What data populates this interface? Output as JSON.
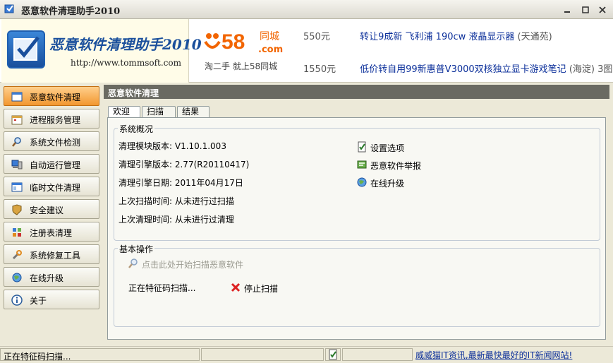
{
  "window": {
    "title": "恶意软件清理助手2010",
    "controls": [
      "minimize",
      "maximize",
      "close"
    ]
  },
  "banner": {
    "logo_title": "恶意软件清理助手2010",
    "logo_url": "http://www.tommsoft.com",
    "ad_brand_number": "58",
    "ad_brand_suffix": "同城",
    "ad_brand_domain": ".com",
    "ad_slogan": "淘二手  就上58同城",
    "ads": [
      {
        "price": "550元",
        "text": "转让9成新  飞利浦  190cw  液晶显示器",
        "extra": "(天通苑)"
      },
      {
        "price": "1550元",
        "text": "低价转自用99新惠普V3000双核独立显卡游戏笔记",
        "extra": "(海淀)  3图"
      }
    ]
  },
  "sidebar": {
    "items": [
      {
        "label": "恶意软件清理",
        "icon": "window-icon",
        "active": true
      },
      {
        "label": "进程服务管理",
        "icon": "calendar-icon",
        "active": false
      },
      {
        "label": "系统文件检测",
        "icon": "magnifier-icon",
        "active": false
      },
      {
        "label": "自动运行管理",
        "icon": "computer-icon",
        "active": false
      },
      {
        "label": "临时文件清理",
        "icon": "window-icon",
        "active": false
      },
      {
        "label": "安全建议",
        "icon": "shield-icon",
        "active": false
      },
      {
        "label": "注册表清理",
        "icon": "registry-icon",
        "active": false
      },
      {
        "label": "系统修复工具",
        "icon": "tools-icon",
        "active": false
      },
      {
        "label": "在线升级",
        "icon": "globe-icon",
        "active": false
      },
      {
        "label": "关于",
        "icon": "info-icon",
        "active": false
      }
    ]
  },
  "main": {
    "header": "恶意软件清理",
    "tabs": [
      {
        "label": "欢迎",
        "active": true
      },
      {
        "label": "扫描",
        "active": false
      },
      {
        "label": "结果",
        "active": false
      }
    ],
    "overview": {
      "title": "系统概况",
      "module_version": "清理模块版本: V1.10.1.003",
      "engine_version": "清理引擎版本: 2.77(R20110417)",
      "engine_date": "清理引擎日期: 2011年04月17日",
      "last_scan": "上次扫描时间: 从未进行过扫描",
      "last_clean": "上次清理时间: 从未进行过清理",
      "links": {
        "settings": "设置选项",
        "report": "恶意软件举报",
        "upgrade": "在线升级"
      }
    },
    "operations": {
      "title": "基本操作",
      "start_scan": "点击此处开始扫描恶意软件",
      "progress": "正在特征码扫描...",
      "stop": "停止扫描"
    }
  },
  "status": {
    "text": "正在特征码扫描...",
    "link": "威威猫IT资讯,最新最快最好的IT新闻网站!"
  },
  "colors": {
    "accent_orange": "#f2972f",
    "header_gray": "#6a6a62",
    "link_blue": "#0b2f9a",
    "brand_orange": "#f26500"
  }
}
